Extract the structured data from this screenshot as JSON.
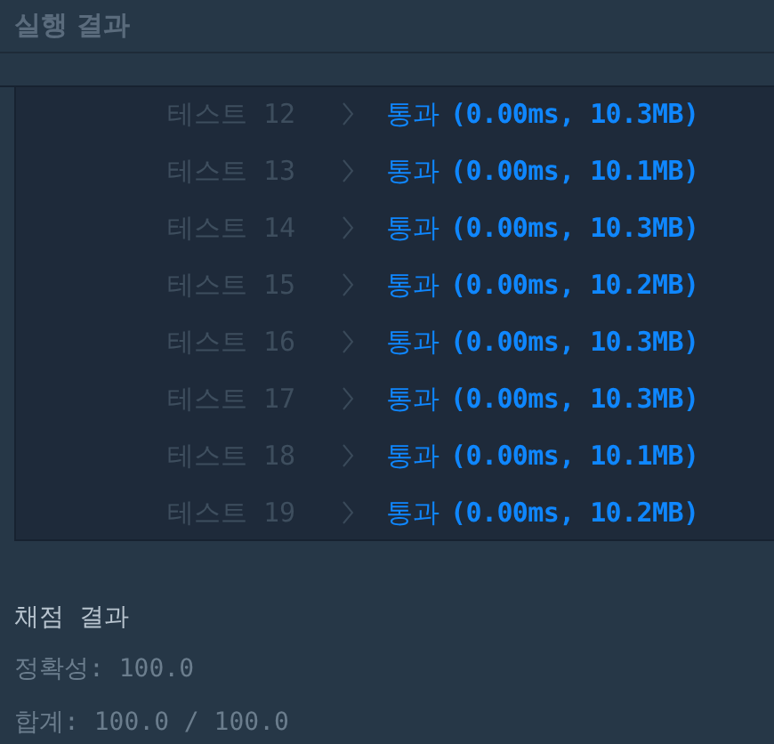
{
  "title": "실행 결과",
  "tests": [
    {
      "label": "테스트 12",
      "status": "통과",
      "detail": "(0.00ms, 10.3MB)"
    },
    {
      "label": "테스트 13",
      "status": "통과",
      "detail": "(0.00ms, 10.1MB)"
    },
    {
      "label": "테스트 14",
      "status": "통과",
      "detail": "(0.00ms, 10.3MB)"
    },
    {
      "label": "테스트 15",
      "status": "통과",
      "detail": "(0.00ms, 10.2MB)"
    },
    {
      "label": "테스트 16",
      "status": "통과",
      "detail": "(0.00ms, 10.3MB)"
    },
    {
      "label": "테스트 17",
      "status": "통과",
      "detail": "(0.00ms, 10.3MB)"
    },
    {
      "label": "테스트 18",
      "status": "통과",
      "detail": "(0.00ms, 10.1MB)"
    },
    {
      "label": "테스트 19",
      "status": "통과",
      "detail": "(0.00ms, 10.2MB)"
    }
  ],
  "grading": {
    "title": "채점 결과",
    "lines": [
      "정확성: 100.0",
      "합계: 100.0 / 100.0"
    ]
  }
}
